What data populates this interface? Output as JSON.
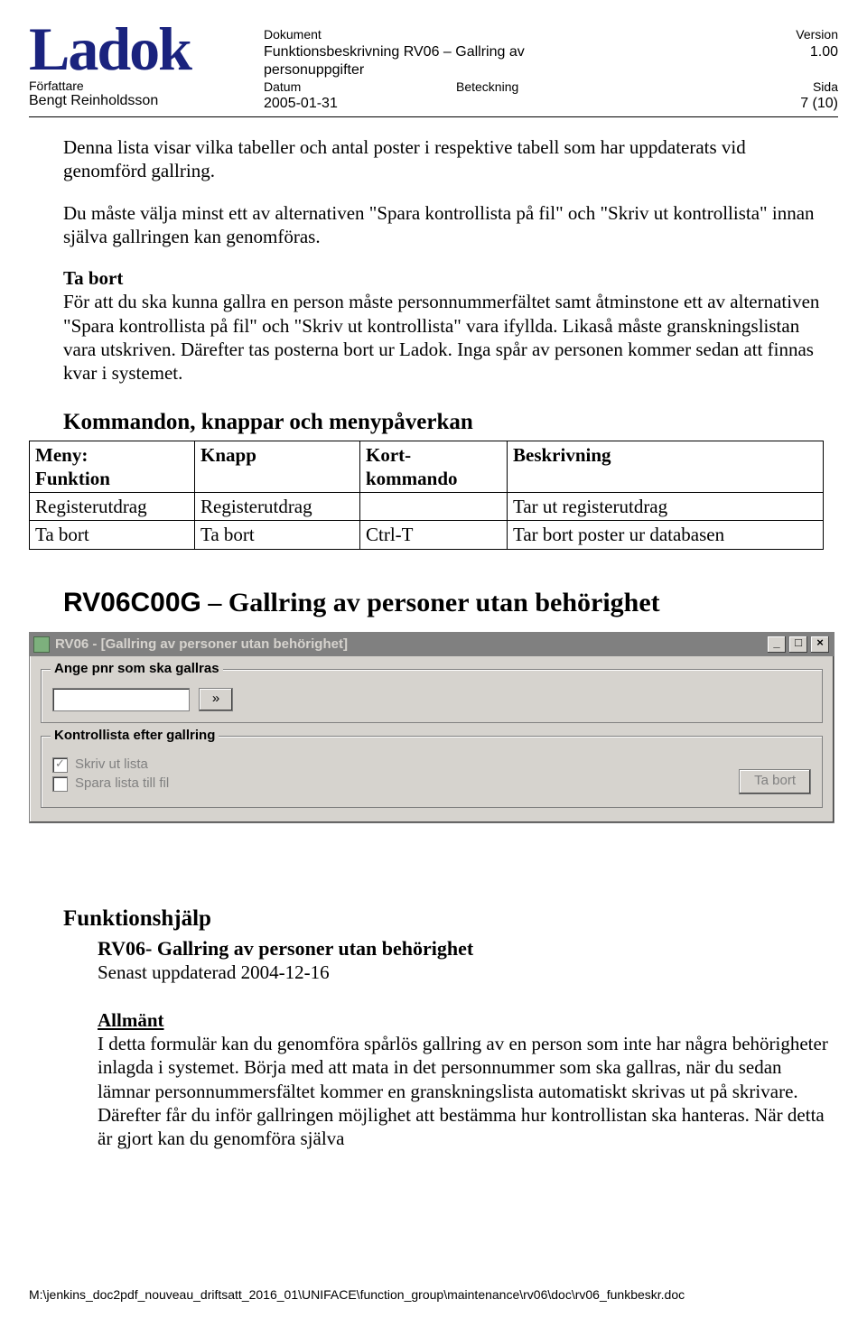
{
  "header": {
    "logo": "Ladok",
    "author_label": "Författare",
    "author_value": "Bengt Reinholdsson",
    "doc_label": "Dokument",
    "doc_value": "Funktionsbeskrivning RV06 – Gallring av personuppgifter",
    "version_label": "Version",
    "version_value": "1.00",
    "date_label": "Datum",
    "date_value": "2005-01-31",
    "sign_label": "Beteckning",
    "page_label": "Sida",
    "page_value": "7 (10)"
  },
  "body": {
    "p1": "Denna lista visar vilka tabeller och antal poster i respektive tabell som har uppdaterats vid genomförd gallring.",
    "p2": "Du måste välja minst ett av alternativen \"Spara kontrollista på fil\" och \"Skriv ut kontrollista\" innan själva gallringen kan genomföras.",
    "ta_bort_h": "Ta bort",
    "ta_bort_txt": "För att du ska kunna gallra en person måste personnummerfältet samt åtminstone ett av alternativen \"Spara kontrollista på fil\" och \"Skriv ut kontrollista\" vara ifyllda. Likaså måste granskningslistan vara utskriven. Därefter tas posterna bort ur Ladok. Inga spår av personen kommer sedan att finnas kvar i systemet."
  },
  "cmd": {
    "heading": "Kommandon, knappar och menypåverkan",
    "headers": {
      "meny": "Meny:\nFunktion",
      "knapp": "Knapp",
      "kort": "Kort-\nkommando",
      "beskr": "Beskrivning"
    },
    "rows": [
      {
        "meny": "Registerutdrag",
        "knapp": "Registerutdrag",
        "kort": "",
        "beskr": "Tar ut registerutdrag"
      },
      {
        "meny": "Ta bort",
        "knapp": "Ta bort",
        "kort": "Ctrl-T",
        "beskr": "Tar bort poster ur databasen"
      }
    ]
  },
  "section2": {
    "code": "RV06C00G",
    "title": " – Gallring av personer utan behörighet"
  },
  "app": {
    "title": "RV06 - [Gallring av personer utan behörighet]",
    "group1": "Ange pnr som ska gallras",
    "pnr_btn": "»",
    "group2": "Kontrollista efter gallring",
    "chk1": "Skriv ut lista",
    "chk2": "Spara lista till fil",
    "ta_bort": "Ta bort",
    "min": "_",
    "max": "□",
    "close": "×"
  },
  "help": {
    "heading": "Funktionshjälp",
    "sub": "RV06- Gallring av personer utan behörighet",
    "updated": "Senast uppdaterad 2004-12-16",
    "allmant_h": "Allmänt",
    "allmant_txt": "I detta formulär kan du genomföra spårlös gallring av en person som inte har några behörigheter inlagda i systemet. Börja med att mata in det personnummer som ska gallras, när du sedan lämnar personnummersfältet kommer en granskningslista automatiskt skrivas ut på skrivare. Därefter får du inför gallringen möjlighet att bestämma hur kontrollistan ska hanteras. När detta är gjort kan du genomföra själva"
  },
  "footer": {
    "path": "M:\\jenkins_doc2pdf_nouveau_driftsatt_2016_01\\UNIFACE\\function_group\\maintenance\\rv06\\doc\\rv06_funkbeskr.doc"
  }
}
